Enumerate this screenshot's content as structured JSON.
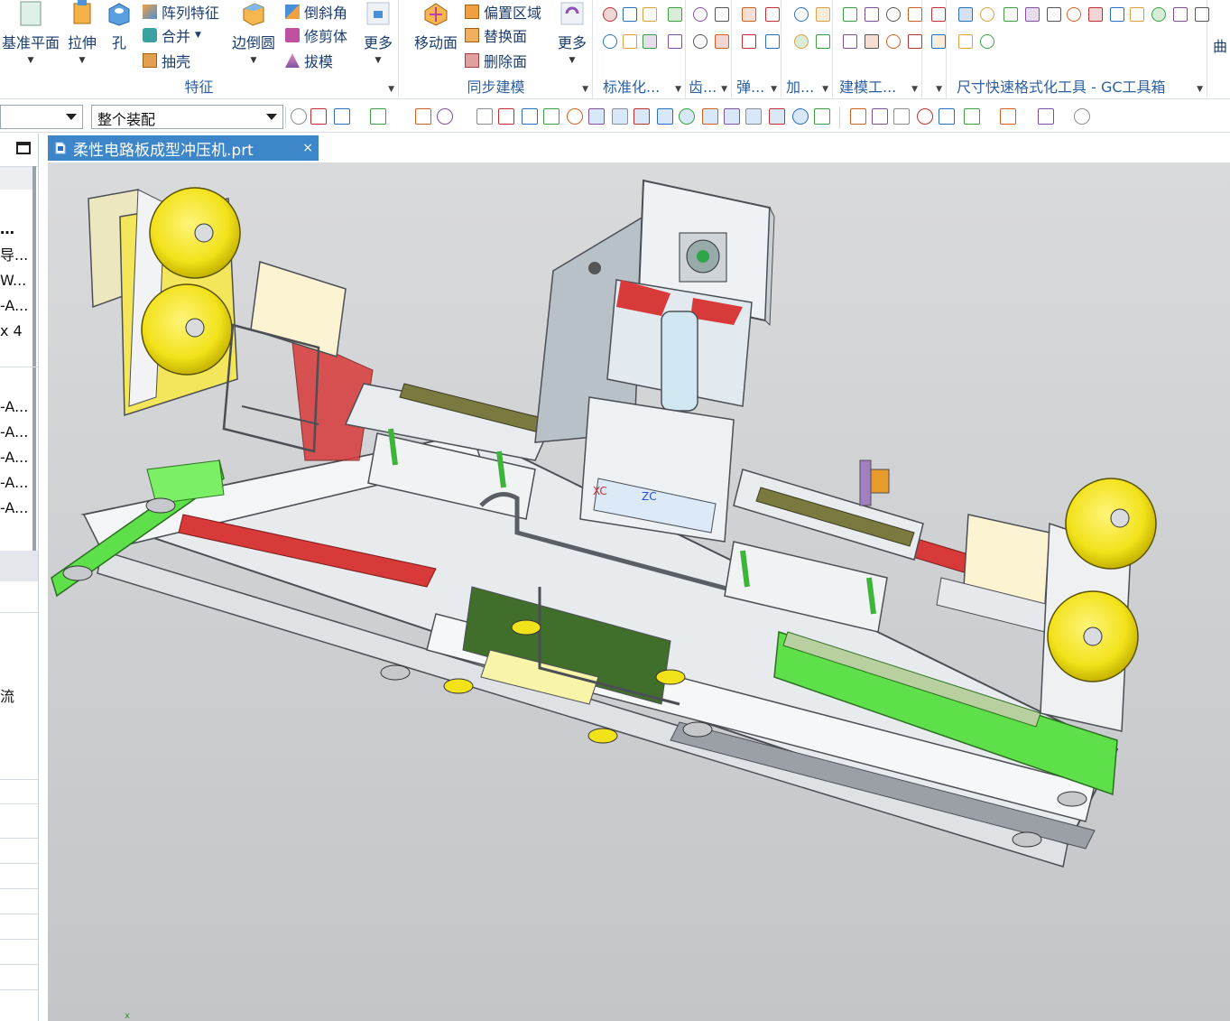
{
  "ribbon": {
    "groups": [
      {
        "label": "特征"
      },
      {
        "label": "同步建模"
      },
      {
        "label": "标准化..."
      },
      {
        "label": "齿..."
      },
      {
        "label": "弹..."
      },
      {
        "label": "加..."
      },
      {
        "label": "建模工..."
      },
      {
        "label": "尺寸快速格式化工具 - GC工具箱"
      }
    ],
    "feature_big": [
      "基准平面",
      "拉伸",
      "孔",
      "边倒圆",
      "更多"
    ],
    "feature_small": [
      "阵列特征",
      "合并",
      "抽壳",
      "倒斜角",
      "修剪体",
      "拔模"
    ],
    "sync_big": [
      "移动面",
      "更多"
    ],
    "sync_small": [
      "偏置区域",
      "替换面",
      "删除面"
    ],
    "overflow_label": "曲"
  },
  "toolbar": {
    "filter_value": "",
    "assembly_scope": "整个装配"
  },
  "left_panel": {
    "rows": [
      "…",
      "导...",
      "W...",
      "-A...",
      "x 4",
      "-A...",
      "-A...",
      "-A...",
      "-A...",
      "-A..."
    ],
    "misc_char": "流"
  },
  "document": {
    "tab_title": "柔性电路板成型冲压机.prt",
    "close_glyph": "×"
  },
  "viewport": {
    "axis_labels": [
      "XC",
      "ZC"
    ],
    "corner_axis": "x"
  },
  "colors": {
    "accent": "#3d86c9",
    "machine_frame": "#e8ebee",
    "yellow_roll": "#f2e21a",
    "green_rail": "#5de04a",
    "red_part": "#d83a3a",
    "viewport_bg": "#cfd1d3"
  }
}
